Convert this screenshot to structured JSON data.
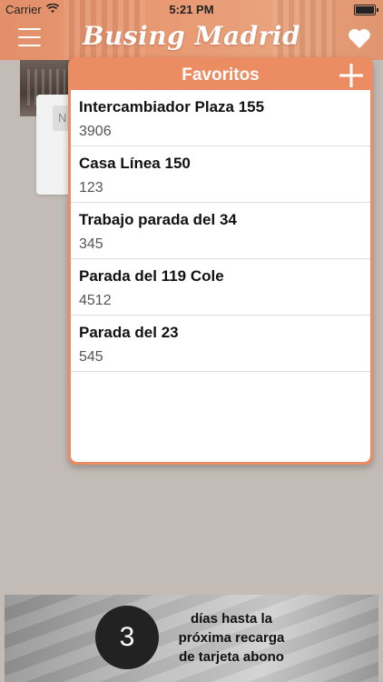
{
  "status_bar": {
    "carrier": "Carrier",
    "time": "5:21 PM"
  },
  "header": {
    "title": "Busing Madrid",
    "icons": [
      "menu-icon",
      "heart-icon"
    ]
  },
  "background": {
    "card_chip": "N"
  },
  "popup": {
    "title": "Favoritos",
    "add_icon": "plus-icon",
    "items": [
      {
        "name": "Intercambiador Plaza 155",
        "code": "3906"
      },
      {
        "name": "Casa Línea 150",
        "code": "123"
      },
      {
        "name": "Trabajo parada del 34",
        "code": "345"
      },
      {
        "name": "Parada del 119 Cole",
        "code": "4512"
      },
      {
        "name": "Parada del 23",
        "code": "545"
      }
    ]
  },
  "banner": {
    "days": "3",
    "line1": "días hasta la",
    "line2": "próxima recarga",
    "line3": "de tarjeta abono"
  },
  "colors": {
    "accent": "#ec8c62",
    "header": "#e89a73",
    "background": "#c2bbb6"
  }
}
